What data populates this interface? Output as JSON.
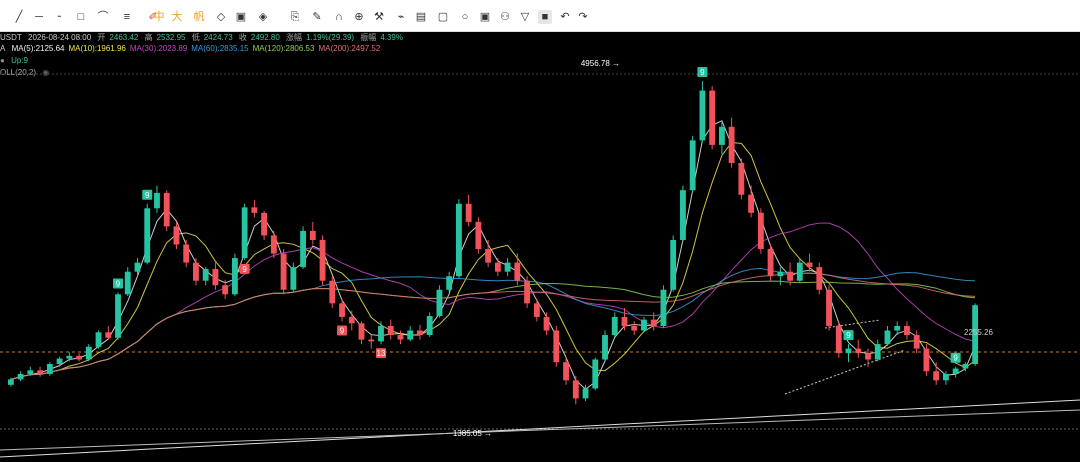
{
  "toolbar": {
    "tools": [
      {
        "name": "crosshair-tool",
        "glyph": "╱"
      },
      {
        "name": "horizontal-line-tool",
        "glyph": "─"
      },
      {
        "name": "trendline-tool",
        "glyph": "╴"
      },
      {
        "name": "rectangle-tool",
        "glyph": "□"
      },
      {
        "name": "path-tool",
        "glyph": "⌒"
      },
      {
        "name": "text-lines-tool",
        "glyph": "≡"
      },
      {
        "name": "brush-tool",
        "glyph": "✐"
      },
      {
        "name": "zhong-tool",
        "glyph": "中"
      },
      {
        "name": "da-tool",
        "glyph": "大"
      },
      {
        "name": "fan-tool",
        "glyph": "帆"
      },
      {
        "name": "pattern-tool",
        "glyph": "◇"
      },
      {
        "name": "image-tool",
        "glyph": "▣"
      },
      {
        "name": "shapes-tool",
        "glyph": "◈"
      },
      {
        "name": "copy-icon",
        "glyph": "⎘"
      },
      {
        "name": "edit-icon",
        "glyph": "✎"
      },
      {
        "name": "magnet-icon",
        "glyph": "∩"
      },
      {
        "name": "zoom-icon",
        "glyph": "⊕"
      },
      {
        "name": "hammer-icon",
        "glyph": "⚒"
      },
      {
        "name": "measure-icon",
        "glyph": "⌁"
      },
      {
        "name": "compare-icon",
        "glyph": "▤"
      },
      {
        "name": "lock-icon",
        "glyph": "▢"
      },
      {
        "name": "visible-icon",
        "glyph": "○"
      },
      {
        "name": "hide-icon",
        "glyph": "▣"
      },
      {
        "name": "tree-icon",
        "glyph": "⚇"
      },
      {
        "name": "filter-icon",
        "glyph": "▽"
      },
      {
        "name": "trash-icon",
        "glyph": "■"
      },
      {
        "name": "undo-icon",
        "glyph": "↶"
      },
      {
        "name": "redo-icon",
        "glyph": "↷"
      }
    ],
    "colors": {
      "accent": "#f0a020",
      "red": "#e04040"
    }
  },
  "ohlc": {
    "symbol": "USDT",
    "date": "2026-08-24 08:00",
    "open_label": "开",
    "open": "2463.42",
    "high_label": "高",
    "high": "2532.95",
    "low_label": "低",
    "low": "2424.73",
    "close_label": "收",
    "close": "2492.80",
    "change_label": "涨幅",
    "change": "1.19%(29.39)",
    "amplitude_label": "振幅",
    "amplitude": "4.39%"
  },
  "ma": {
    "prefix": "A",
    "items": [
      {
        "label": "MA(5):2125.64",
        "color": "#f0f0f0"
      },
      {
        "label": "MA(10):1961.96",
        "color": "#f2e64b"
      },
      {
        "label": "MA(30):2023.89",
        "color": "#c846c8"
      },
      {
        "label": "MA(60):2835.15",
        "color": "#3a9ad9"
      },
      {
        "label": "MA(120):2806.53",
        "color": "#8fd14f"
      },
      {
        "label": "MA(200):2497.52",
        "color": "#e07070"
      }
    ]
  },
  "indicator_up": "Up:9",
  "indicator_boll": "OLL(20,2)",
  "chart_data": {
    "type": "candlestick",
    "y_axis": "price",
    "price_labels": {
      "high": "4956.78",
      "low": "1385.05",
      "current": "2255.26"
    },
    "td_markers": [
      "9",
      "9",
      "9",
      "9",
      "13",
      "9",
      "9",
      "9"
    ],
    "candles": [
      [
        1600,
        1680,
        1580,
        1660
      ],
      [
        1660,
        1750,
        1640,
        1720
      ],
      [
        1720,
        1800,
        1700,
        1760
      ],
      [
        1760,
        1800,
        1690,
        1720
      ],
      [
        1720,
        1850,
        1700,
        1830
      ],
      [
        1830,
        1910,
        1800,
        1890
      ],
      [
        1890,
        1960,
        1860,
        1920
      ],
      [
        1920,
        1950,
        1860,
        1880
      ],
      [
        1880,
        2050,
        1860,
        2020
      ],
      [
        2020,
        2200,
        2000,
        2180
      ],
      [
        2180,
        2250,
        2100,
        2120
      ],
      [
        2120,
        2620,
        2100,
        2600
      ],
      [
        2600,
        2900,
        2580,
        2850
      ],
      [
        2850,
        3000,
        2800,
        2950
      ],
      [
        2950,
        3600,
        2930,
        3550
      ],
      [
        3550,
        3800,
        3500,
        3720
      ],
      [
        3720,
        3750,
        3300,
        3350
      ],
      [
        3350,
        3400,
        3100,
        3150
      ],
      [
        3150,
        3200,
        2900,
        2950
      ],
      [
        2950,
        3000,
        2700,
        2750
      ],
      [
        2750,
        2900,
        2700,
        2880
      ],
      [
        2880,
        2950,
        2650,
        2700
      ],
      [
        2700,
        2760,
        2550,
        2600
      ],
      [
        2600,
        3050,
        2580,
        3000
      ],
      [
        3000,
        3600,
        2980,
        3560
      ],
      [
        3560,
        3640,
        3450,
        3500
      ],
      [
        3500,
        3520,
        3200,
        3250
      ],
      [
        3250,
        3300,
        3000,
        3050
      ],
      [
        3050,
        3100,
        2600,
        2650
      ],
      [
        2650,
        2950,
        2620,
        2900
      ],
      [
        2900,
        3350,
        2880,
        3300
      ],
      [
        3300,
        3400,
        3150,
        3200
      ],
      [
        3200,
        3250,
        2700,
        2750
      ],
      [
        2750,
        2800,
        2450,
        2500
      ],
      [
        2500,
        2550,
        2300,
        2350
      ],
      [
        2350,
        2420,
        2200,
        2280
      ],
      [
        2280,
        2300,
        2050,
        2100
      ],
      [
        2100,
        2150,
        2000,
        2080
      ],
      [
        2080,
        2300,
        2050,
        2250
      ],
      [
        2250,
        2320,
        2100,
        2150
      ],
      [
        2150,
        2200,
        2050,
        2100
      ],
      [
        2100,
        2250,
        2080,
        2200
      ],
      [
        2200,
        2260,
        2100,
        2150
      ],
      [
        2150,
        2400,
        2130,
        2360
      ],
      [
        2360,
        2700,
        2340,
        2650
      ],
      [
        2650,
        2850,
        2620,
        2800
      ],
      [
        2800,
        3650,
        2780,
        3600
      ],
      [
        3600,
        3700,
        3350,
        3400
      ],
      [
        3400,
        3450,
        3050,
        3100
      ],
      [
        3100,
        3200,
        2900,
        2950
      ],
      [
        2950,
        3000,
        2800,
        2850
      ],
      [
        2850,
        3000,
        2800,
        2950
      ],
      [
        2950,
        3050,
        2700,
        2750
      ],
      [
        2750,
        2800,
        2450,
        2500
      ],
      [
        2500,
        2550,
        2300,
        2350
      ],
      [
        2350,
        2400,
        2150,
        2200
      ],
      [
        2200,
        2250,
        1800,
        1850
      ],
      [
        1850,
        1900,
        1600,
        1650
      ],
      [
        1650,
        1700,
        1385,
        1450
      ],
      [
        1450,
        1600,
        1420,
        1560
      ],
      [
        1560,
        1900,
        1540,
        1880
      ],
      [
        1880,
        2200,
        1860,
        2150
      ],
      [
        2150,
        2400,
        2130,
        2350
      ],
      [
        2350,
        2450,
        2200,
        2250
      ],
      [
        2250,
        2300,
        2150,
        2200
      ],
      [
        2200,
        2350,
        2180,
        2320
      ],
      [
        2320,
        2400,
        2200,
        2250
      ],
      [
        2250,
        2700,
        2230,
        2650
      ],
      [
        2650,
        3250,
        2630,
        3200
      ],
      [
        3200,
        3800,
        3180,
        3750
      ],
      [
        3750,
        4350,
        3730,
        4300
      ],
      [
        4300,
        4956,
        4280,
        4850
      ],
      [
        4850,
        4900,
        4200,
        4250
      ],
      [
        4250,
        4500,
        4150,
        4450
      ],
      [
        4450,
        4550,
        4000,
        4050
      ],
      [
        4050,
        4100,
        3650,
        3700
      ],
      [
        3700,
        3800,
        3450,
        3500
      ],
      [
        3500,
        3550,
        3050,
        3100
      ],
      [
        3100,
        3150,
        2750,
        2800
      ],
      [
        2800,
        2900,
        2700,
        2850
      ],
      [
        2850,
        2950,
        2700,
        2750
      ],
      [
        2750,
        3000,
        2730,
        2950
      ],
      [
        2950,
        3050,
        2850,
        2900
      ],
      [
        2900,
        2950,
        2600,
        2650
      ],
      [
        2650,
        2700,
        2200,
        2250
      ],
      [
        2250,
        2300,
        1900,
        1950
      ],
      [
        1950,
        2050,
        1850,
        2000
      ],
      [
        2000,
        2100,
        1900,
        1950
      ],
      [
        1950,
        2000,
        1800,
        1880
      ],
      [
        1880,
        2100,
        1860,
        2050
      ],
      [
        2050,
        2250,
        2030,
        2200
      ],
      [
        2200,
        2300,
        2150,
        2250
      ],
      [
        2250,
        2300,
        2100,
        2150
      ],
      [
        2150,
        2200,
        1950,
        2000
      ],
      [
        2000,
        2050,
        1700,
        1750
      ],
      [
        1750,
        1850,
        1600,
        1650
      ],
      [
        1650,
        1750,
        1600,
        1720
      ],
      [
        1720,
        1800,
        1680,
        1780
      ],
      [
        1780,
        1850,
        1750,
        1830
      ],
      [
        1830,
        2500,
        1810,
        2480
      ]
    ]
  }
}
